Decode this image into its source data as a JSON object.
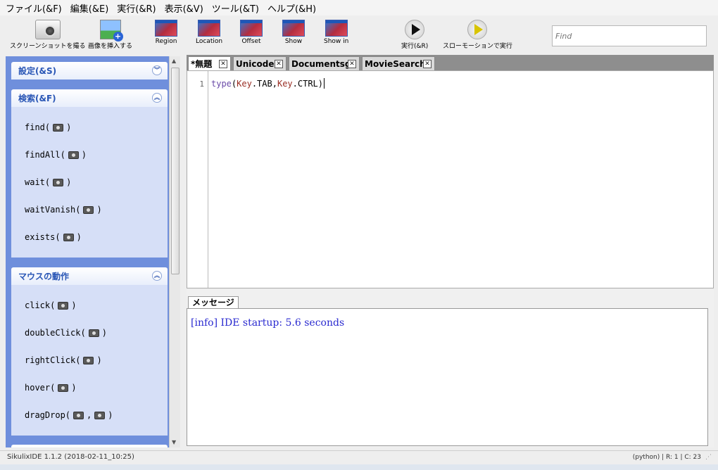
{
  "menu": [
    "ファイル(&F)",
    "編集(&E)",
    "実行(&R)",
    "表示(&V)",
    "ツール(&T)",
    "ヘルプ(&H)"
  ],
  "toolbar": {
    "screenshot": "スクリーンショットを撮る",
    "insert_image": "画像を挿入する",
    "region": "Region",
    "location": "Location",
    "offset": "Offset",
    "show": "Show",
    "show_in": "Show in",
    "run": "実行(&R)",
    "slow_run": "スローモーションで実行",
    "find_placeholder": "Find"
  },
  "sidebar": {
    "settings": "設定(&S)",
    "search": {
      "title": "検索(&F)",
      "items": [
        "find(",
        "findAll(",
        "wait(",
        "waitVanish(",
        "exists("
      ]
    },
    "mouse": {
      "title": "マウスの動作",
      "items": [
        "click(",
        "doubleClick(",
        "rightClick(",
        "hover(",
        "dragDrop("
      ]
    },
    "close_paren": ")",
    "comma": ","
  },
  "tabs": [
    "*無題",
    "Unicode",
    "Documentsg",
    "MovieSearch"
  ],
  "editor": {
    "line_number": "1",
    "code": {
      "fn": "type",
      "open": "(",
      "arg1": "Key",
      "arg1b": ".TAB",
      "sep": ",",
      "arg2": "Key",
      "arg2b": ".CTRL",
      "close": ")"
    }
  },
  "messages": {
    "tab": "メッセージ",
    "line": "[info] IDE startup: 5.6 seconds"
  },
  "status": {
    "left": "SikulixIDE 1.1.2 (2018-02-11_10:25)",
    "right": "(python) | R: 1 | C: 23"
  }
}
